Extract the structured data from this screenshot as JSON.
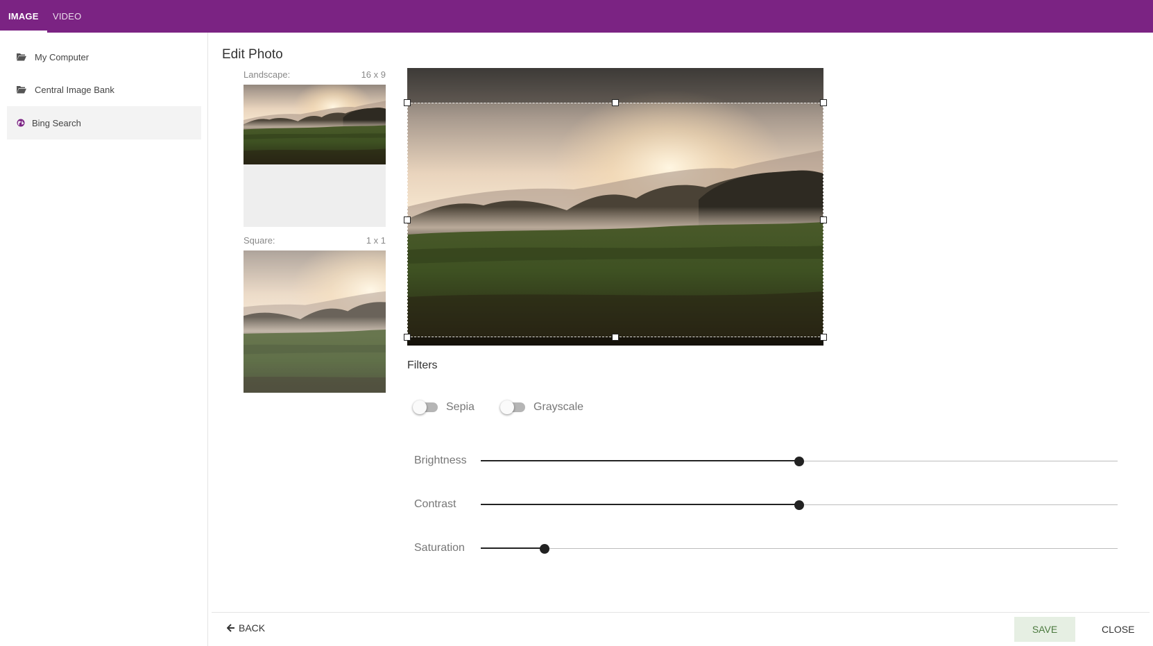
{
  "tabs": [
    {
      "label": "IMAGE",
      "active": true
    },
    {
      "label": "VIDEO",
      "active": false
    }
  ],
  "sidebar": {
    "items": [
      {
        "label": "My Computer",
        "icon": "folder-open-icon"
      },
      {
        "label": "Central Image Bank",
        "icon": "folder-open-icon"
      },
      {
        "label": "Bing Search",
        "icon": "globe-icon",
        "active": true
      }
    ]
  },
  "editor": {
    "title": "Edit Photo",
    "crops": [
      {
        "label": "Landscape:",
        "ratio": "16 x 9"
      },
      {
        "label": "Square:",
        "ratio": "1 x 1"
      }
    ],
    "filters_title": "Filters",
    "toggles": [
      {
        "label": "Sepia",
        "on": false
      },
      {
        "label": "Grayscale",
        "on": false
      }
    ],
    "sliders": [
      {
        "label": "Brightness",
        "value": 0.5
      },
      {
        "label": "Contrast",
        "value": 0.5
      },
      {
        "label": "Saturation",
        "value": 0.1
      }
    ]
  },
  "footer": {
    "back_label": "BACK",
    "save_label": "SAVE",
    "close_label": "CLOSE"
  },
  "colors": {
    "brand": "#7b2383",
    "save_bg": "#e6efe3",
    "save_text": "#4c7a3f"
  }
}
